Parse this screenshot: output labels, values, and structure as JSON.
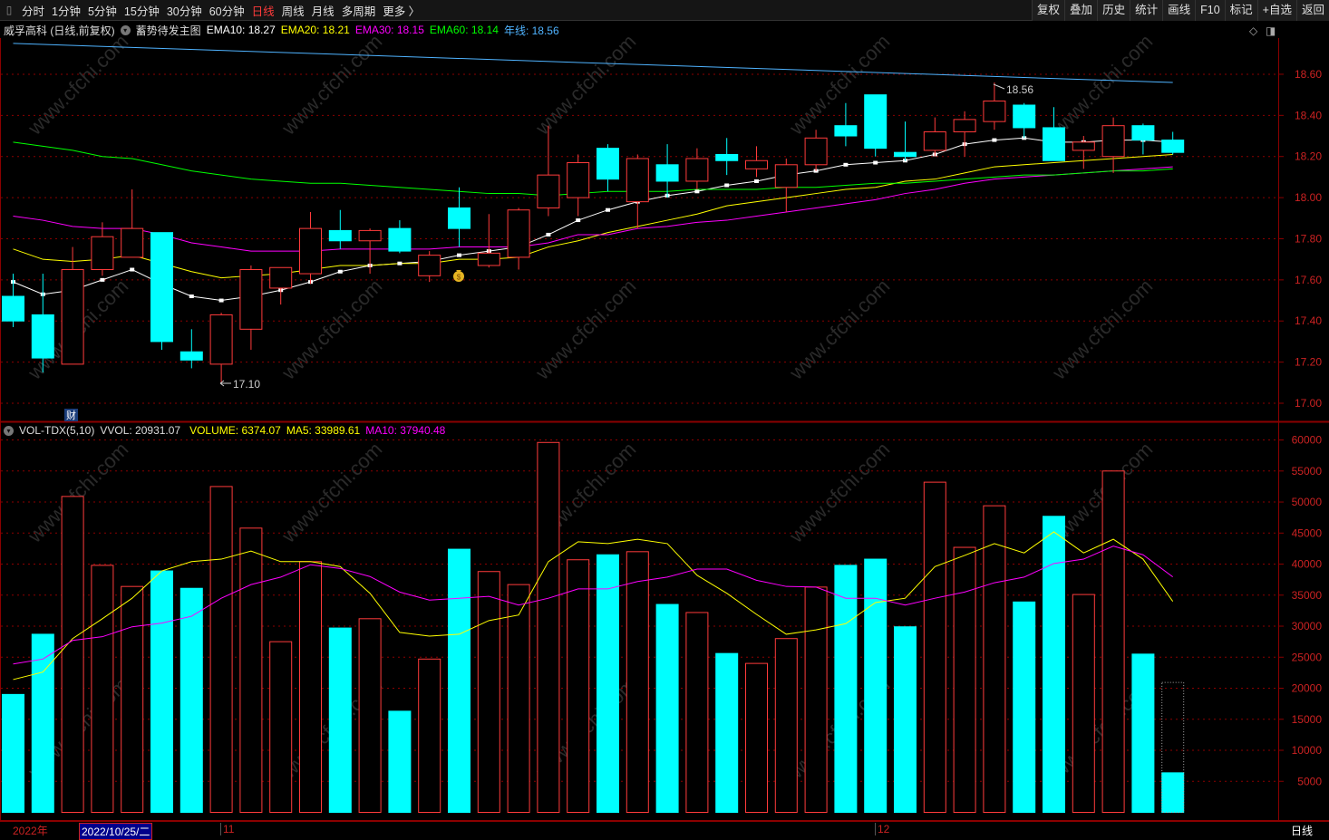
{
  "toolbar": {
    "periods": [
      "分时",
      "1分钟",
      "5分钟",
      "15分钟",
      "30分钟",
      "60分钟",
      "日线",
      "周线",
      "月线",
      "多周期",
      "更多 〉"
    ],
    "active_period": "日线",
    "right_buttons": [
      "复权",
      "叠加",
      "历史",
      "统计",
      "画线",
      "F10",
      "标记",
      "+自选",
      "返回"
    ]
  },
  "info": {
    "title": "威孚高科 (日线,前复权)",
    "template": "蓄势待发主图",
    "ema10": "EMA10: 18.27",
    "ema20": "EMA20: 18.21",
    "ema30": "EMA30: 18.15",
    "ema60": "EMA60: 18.14",
    "yearline": "年线: 18.56"
  },
  "vol_info": {
    "name": "VOL-TDX(5,10)",
    "vvol": "VVOL: 20931.07",
    "volume": "VOLUME: 6374.07",
    "ma5": "MA5: 33989.61",
    "ma10": "MA10: 37940.48"
  },
  "markers": {
    "fin_label": "财",
    "high_label": "18.56",
    "low_label": "17.10"
  },
  "bottom": {
    "year": "2022年",
    "cursor_date": "2022/10/25/二",
    "month_11": "11",
    "month_12": "12",
    "period": "日线"
  },
  "watermark": "www.cfchi.com",
  "colors": {
    "up": "#ff3b3b",
    "down": "#00ffff",
    "ema10": "#ffffff",
    "ema20": "#ffff00",
    "ema30": "#ff00ff",
    "ema60": "#00ff00",
    "year": "#4fb3ff",
    "grid": "#8b0000"
  },
  "chart_data": [
    {
      "type": "candlestick",
      "title": "威孚高科 日线",
      "ylim": [
        16.95,
        18.78
      ],
      "yticks": [
        "17.00",
        "17.20",
        "17.40",
        "17.60",
        "17.80",
        "18.00",
        "18.20",
        "18.40",
        "18.60"
      ],
      "ohlc": [
        [
          17.52,
          17.63,
          17.37,
          17.4
        ],
        [
          17.43,
          17.63,
          17.15,
          17.22
        ],
        [
          17.19,
          17.76,
          17.19,
          17.65
        ],
        [
          17.65,
          17.88,
          17.62,
          17.81
        ],
        [
          17.71,
          18.04,
          17.71,
          17.85
        ],
        [
          17.83,
          17.83,
          17.26,
          17.3
        ],
        [
          17.25,
          17.36,
          17.17,
          17.21
        ],
        [
          17.19,
          17.44,
          17.1,
          17.43
        ],
        [
          17.36,
          17.67,
          17.26,
          17.65
        ],
        [
          17.56,
          17.66,
          17.48,
          17.66
        ],
        [
          17.63,
          17.93,
          17.58,
          17.85
        ],
        [
          17.84,
          17.94,
          17.75,
          17.79
        ],
        [
          17.79,
          17.85,
          17.63,
          17.84
        ],
        [
          17.85,
          17.89,
          17.73,
          17.74
        ],
        [
          17.62,
          17.74,
          17.59,
          17.72
        ],
        [
          17.95,
          18.05,
          17.76,
          17.85
        ],
        [
          17.67,
          17.92,
          17.66,
          17.73
        ],
        [
          17.71,
          17.95,
          17.65,
          17.94
        ],
        [
          17.95,
          18.35,
          17.91,
          18.11
        ],
        [
          18.0,
          18.21,
          17.91,
          18.17
        ],
        [
          18.24,
          18.26,
          18.03,
          18.09
        ],
        [
          17.98,
          18.21,
          17.85,
          18.19
        ],
        [
          18.16,
          18.26,
          18.0,
          18.08
        ],
        [
          18.08,
          18.24,
          18.04,
          18.19
        ],
        [
          18.21,
          18.29,
          18.11,
          18.18
        ],
        [
          18.14,
          18.25,
          18.1,
          18.18
        ],
        [
          18.05,
          18.19,
          17.93,
          18.16
        ],
        [
          18.16,
          18.33,
          18.13,
          18.29
        ],
        [
          18.35,
          18.46,
          18.25,
          18.3
        ],
        [
          18.5,
          18.5,
          18.2,
          18.24
        ],
        [
          18.22,
          18.37,
          18.18,
          18.2
        ],
        [
          18.23,
          18.39,
          18.2,
          18.32
        ],
        [
          18.32,
          18.42,
          18.2,
          18.38
        ],
        [
          18.37,
          18.56,
          18.33,
          18.47
        ],
        [
          18.45,
          18.46,
          18.29,
          18.34
        ],
        [
          18.34,
          18.44,
          18.18,
          18.18
        ],
        [
          18.23,
          18.3,
          18.14,
          18.27
        ],
        [
          18.2,
          18.39,
          18.12,
          18.35
        ],
        [
          18.35,
          18.36,
          18.21,
          18.28
        ],
        [
          18.28,
          18.32,
          18.21,
          18.22
        ]
      ],
      "series": [
        {
          "name": "EMA10",
          "values": [
            17.59,
            17.53,
            17.55,
            17.6,
            17.65,
            17.58,
            17.52,
            17.5,
            17.52,
            17.55,
            17.59,
            17.64,
            17.67,
            17.68,
            17.69,
            17.72,
            17.74,
            17.76,
            17.82,
            17.89,
            17.94,
            17.98,
            18.01,
            18.03,
            18.06,
            18.08,
            18.11,
            18.13,
            18.16,
            18.17,
            18.18,
            18.21,
            18.26,
            18.28,
            18.29,
            18.27,
            18.27,
            18.28,
            18.28,
            18.27
          ]
        },
        {
          "name": "EMA20",
          "values": [
            17.75,
            17.7,
            17.69,
            17.7,
            17.72,
            17.68,
            17.64,
            17.61,
            17.62,
            17.63,
            17.65,
            17.67,
            17.67,
            17.68,
            17.68,
            17.7,
            17.7,
            17.71,
            17.76,
            17.79,
            17.83,
            17.86,
            17.89,
            17.92,
            17.96,
            17.98,
            18.0,
            18.02,
            18.04,
            18.05,
            18.08,
            18.09,
            18.12,
            18.15,
            18.16,
            18.17,
            18.18,
            18.19,
            18.2,
            18.21
          ]
        },
        {
          "name": "EMA30",
          "values": [
            17.91,
            17.89,
            17.86,
            17.85,
            17.85,
            17.82,
            17.78,
            17.76,
            17.74,
            17.74,
            17.74,
            17.75,
            17.75,
            17.75,
            17.75,
            17.76,
            17.76,
            17.76,
            17.78,
            17.82,
            17.82,
            17.85,
            17.86,
            17.88,
            17.89,
            17.91,
            17.93,
            17.95,
            17.97,
            17.99,
            18.02,
            18.04,
            18.07,
            18.09,
            18.1,
            18.11,
            18.12,
            18.13,
            18.14,
            18.15
          ]
        },
        {
          "name": "EMA60",
          "values": [
            18.27,
            18.25,
            18.23,
            18.2,
            18.19,
            18.16,
            18.13,
            18.11,
            18.09,
            18.08,
            18.07,
            18.07,
            18.06,
            18.05,
            18.04,
            18.03,
            18.02,
            18.02,
            18.01,
            18.02,
            18.03,
            18.03,
            18.03,
            18.04,
            18.04,
            18.04,
            18.05,
            18.05,
            18.06,
            18.07,
            18.07,
            18.08,
            18.09,
            18.1,
            18.11,
            18.11,
            18.12,
            18.13,
            18.13,
            18.14
          ]
        },
        {
          "name": "年线",
          "start": 18.75,
          "end": 18.56
        }
      ]
    },
    {
      "type": "bar",
      "title": "VOL-TDX(5,10)",
      "ylim": [
        0,
        61500
      ],
      "yticks": [
        "5000",
        "10000",
        "15000",
        "20000",
        "25000",
        "30000",
        "35000",
        "40000",
        "45000",
        "50000",
        "55000",
        "60000"
      ],
      "values": [
        19000,
        28700,
        50900,
        39800,
        36400,
        38900,
        36100,
        52500,
        45800,
        27500,
        40400,
        29700,
        31200,
        16300,
        24700,
        42400,
        38800,
        36700,
        59600,
        40700,
        41500,
        42000,
        33500,
        32200,
        25600,
        24000,
        28000,
        36300,
        39800,
        40800,
        29900,
        53200,
        42700,
        49400,
        33900,
        47700,
        35100,
        55000,
        25500,
        6374.07
      ],
      "last_vvol": 20931.07,
      "series": [
        {
          "name": "MA5",
          "values": [
            21400,
            22600,
            28000,
            31200,
            34500,
            38900,
            40400,
            40800,
            42100,
            40400,
            40400,
            39600,
            35300,
            29000,
            28400,
            28700,
            30900,
            31800,
            40400,
            43600,
            43300,
            44000,
            43300,
            38200,
            35300,
            31900,
            28700,
            29400,
            30400,
            33800,
            34500,
            39600,
            41400,
            43300,
            41800,
            45200,
            41800,
            44000,
            40800,
            33989.61
          ]
        },
        {
          "name": "MA10",
          "values": [
            23900,
            24700,
            27700,
            28300,
            29900,
            30500,
            31600,
            34500,
            36700,
            37900,
            39900,
            39300,
            38000,
            35500,
            34200,
            34500,
            34800,
            33400,
            34500,
            36000,
            36000,
            37200,
            37900,
            39200,
            39200,
            37400,
            36400,
            36300,
            34500,
            34500,
            33400,
            34500,
            35500,
            37000,
            37900,
            40100,
            40800,
            42900,
            41500,
            37940.48
          ]
        }
      ]
    }
  ]
}
